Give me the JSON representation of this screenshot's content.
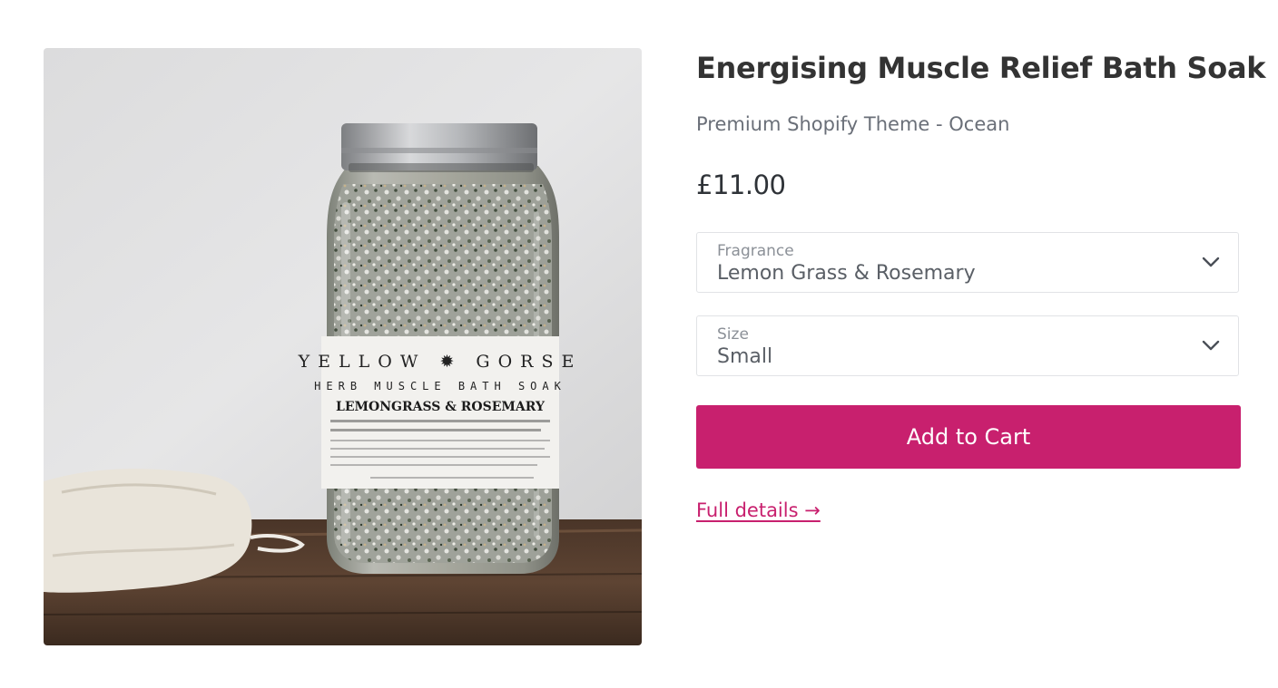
{
  "colors": {
    "accent": "#c8206e",
    "title": "#333333",
    "muted": "#6a6f78",
    "border": "#e1e3e6"
  },
  "product": {
    "title": "Energising Muscle Relief Bath Soak",
    "vendor": "Premium Shopify Theme - Ocean",
    "price": "£11.00",
    "image": {
      "label_brand_left": "YELLOW",
      "label_brand_right": "GORSE",
      "label_subtitle": "HERB MUSCLE BATH SOAK",
      "label_scent": "LEMONGRASS & ROSEMARY"
    }
  },
  "options": {
    "fragrance": {
      "label": "Fragrance",
      "value": "Lemon Grass & Rosemary"
    },
    "size": {
      "label": "Size",
      "value": "Small"
    }
  },
  "actions": {
    "add_to_cart": "Add to Cart",
    "full_details": "Full details →"
  },
  "icons": {
    "select_chevron": "chevron-down-icon"
  }
}
